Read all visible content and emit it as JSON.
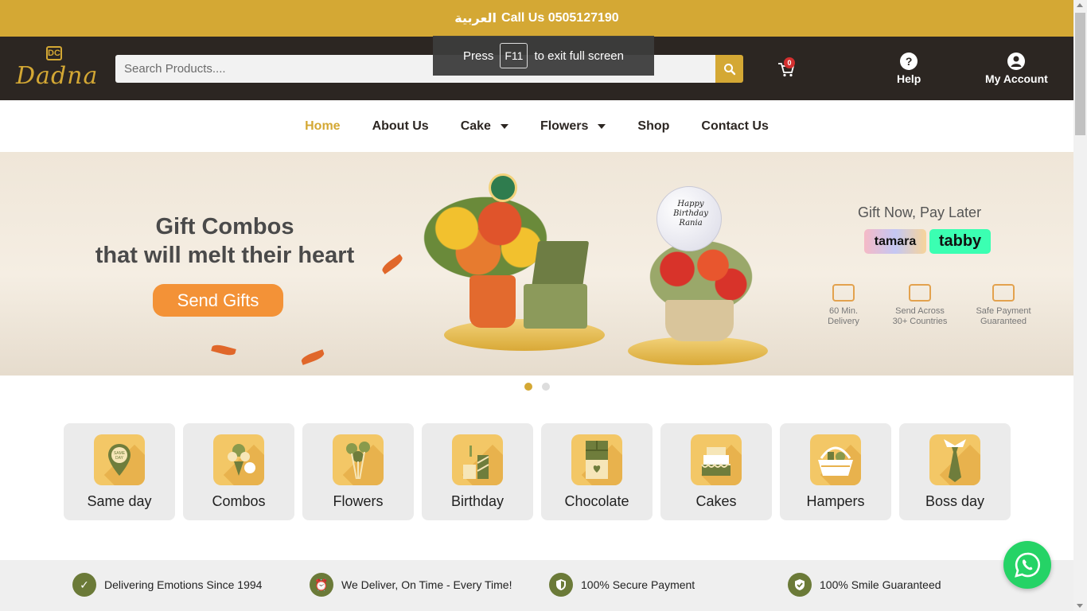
{
  "topbar": {
    "arabic_label": "العربية",
    "call_label": "Call Us 0505127190"
  },
  "header": {
    "logo_text": "Dadna",
    "logo_monogram": "DC",
    "search_placeholder": "Search Products....",
    "cart_count": "0",
    "help_label": "Help",
    "account_label": "My Account"
  },
  "fullscreen_toast": {
    "press": "Press",
    "key": "F11",
    "rest": "to exit full screen"
  },
  "nav": {
    "items": [
      {
        "label": "Home"
      },
      {
        "label": "About Us"
      },
      {
        "label": "Cake"
      },
      {
        "label": "Flowers"
      },
      {
        "label": "Shop"
      },
      {
        "label": "Contact Us"
      }
    ]
  },
  "hero": {
    "title_line1": "Gift Combos",
    "title_line2": "that will melt their heart",
    "button_label": "Send Gifts",
    "balloon_text": "Happy Birthday Rania",
    "pay_later": "Gift Now, Pay Later",
    "tamara": "tamara",
    "tabby": "tabby",
    "features": [
      {
        "line1": "60 Min.",
        "line2": "Delivery"
      },
      {
        "line1": "Send Across",
        "line2": "30+ Countries"
      },
      {
        "line1": "Safe Payment",
        "line2": "Guaranteed"
      }
    ],
    "slide_count": 2,
    "active_slide": 1
  },
  "categories": [
    {
      "label": "Same day",
      "icon": "same-day-icon"
    },
    {
      "label": "Combos",
      "icon": "combos-icon"
    },
    {
      "label": "Flowers",
      "icon": "flowers-icon"
    },
    {
      "label": "Birthday",
      "icon": "birthday-icon"
    },
    {
      "label": "Chocolate",
      "icon": "chocolate-icon"
    },
    {
      "label": "Cakes",
      "icon": "cakes-icon"
    },
    {
      "label": "Hampers",
      "icon": "hampers-icon"
    },
    {
      "label": "Boss day",
      "icon": "boss-day-icon"
    }
  ],
  "trust": [
    {
      "label": "Delivering Emotions Since 1994"
    },
    {
      "label": "We Deliver, On Time - Every Time!"
    },
    {
      "label": "100% Secure Payment"
    },
    {
      "label": "100% Smile Guaranteed"
    }
  ],
  "colors": {
    "brand_gold": "#d4a834",
    "header_dark": "#2c2622",
    "cta_orange": "#f39237",
    "olive": "#6b7a38",
    "whatsapp": "#25d366"
  }
}
